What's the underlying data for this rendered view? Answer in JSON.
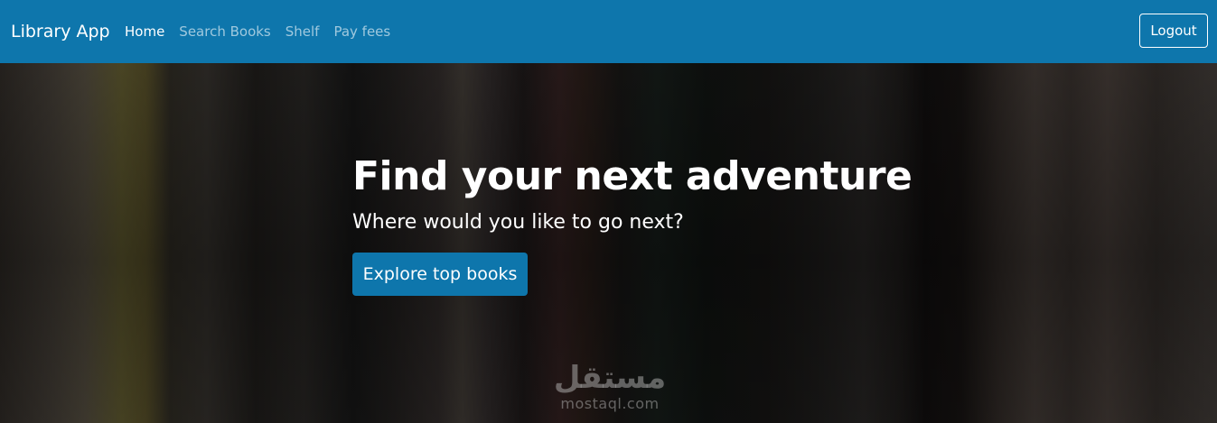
{
  "navbar": {
    "brand": "Library App",
    "links": [
      {
        "label": "Home",
        "active": true
      },
      {
        "label": "Search Books",
        "active": false
      },
      {
        "label": "Shelf",
        "active": false
      },
      {
        "label": "Pay fees",
        "active": false
      }
    ],
    "logout_label": "Logout",
    "background_color": "#0e76ac"
  },
  "hero": {
    "title": "Find your next adventure",
    "subtitle": "Where would you like to go next?",
    "button_label": "Explore top books",
    "button_color": "#0e76ac"
  },
  "watermark": {
    "arabic_text": "مستقل",
    "latin_text": "mostaql.com"
  }
}
